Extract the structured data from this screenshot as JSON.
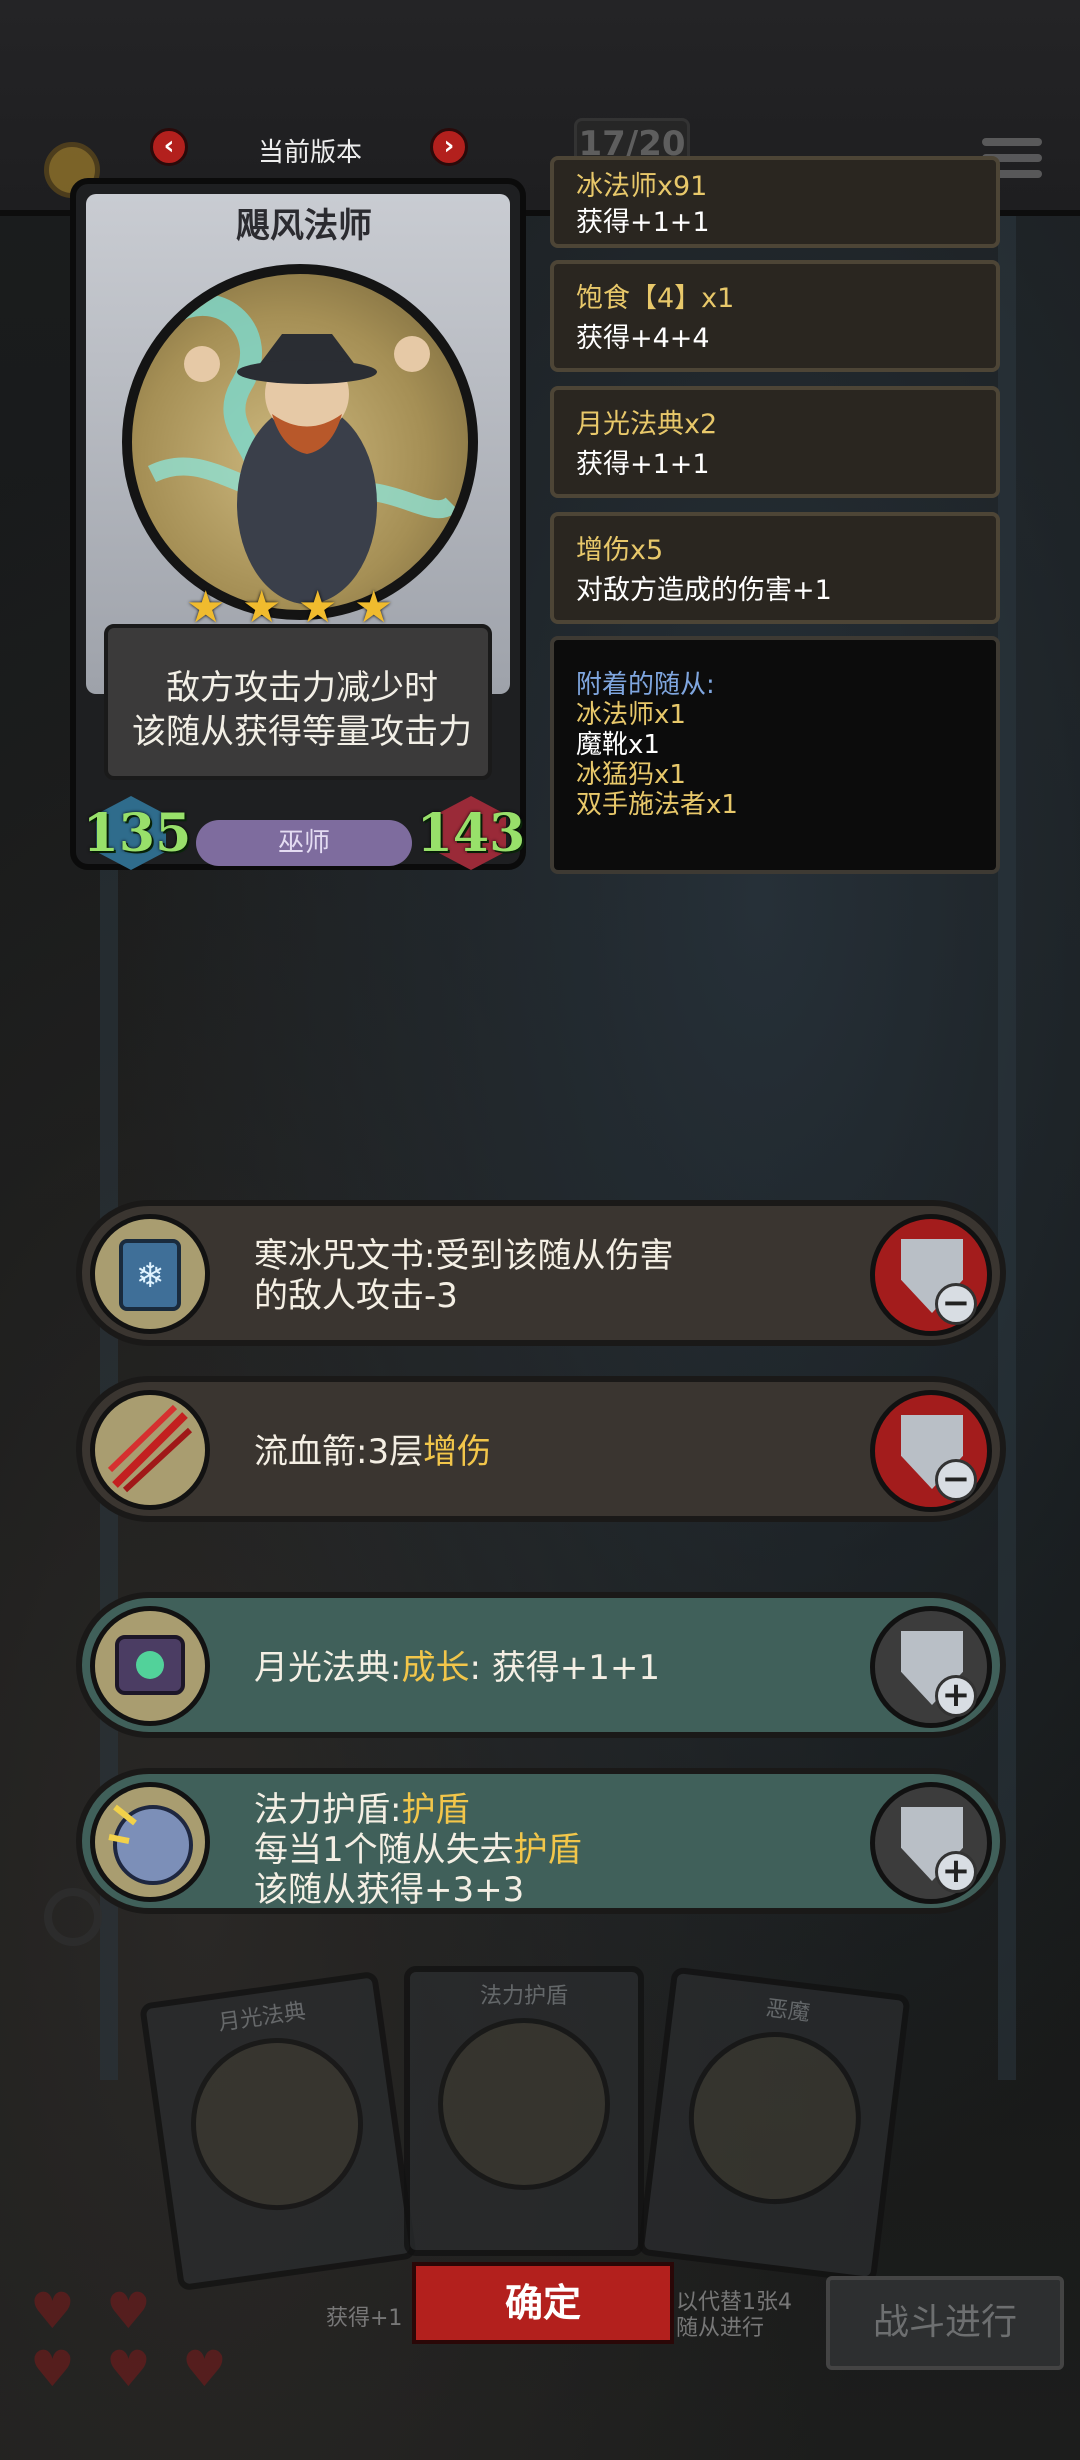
{
  "header": {
    "version_label": "当前版本",
    "prev_label": "‹",
    "next_label": "›",
    "counter": "17/20"
  },
  "hero": {
    "name": "飓风法师",
    "stars": 4,
    "description_line1": "敌方攻击力减少时",
    "description_line2": "该随从获得等量攻击力",
    "attack": "135",
    "health": "143",
    "tribe": "巫师"
  },
  "buffs": [
    {
      "title": "冰法师x91",
      "effect": "获得+1+1"
    },
    {
      "title": "饱食【4】x1",
      "effect": "获得+4+4"
    },
    {
      "title": "月光法典x2",
      "effect": "获得+1+1"
    },
    {
      "title": "增伤x5",
      "effect": "对敌方造成的伤害+1"
    }
  ],
  "attached": {
    "heading": "附着的随从:",
    "items": [
      {
        "label": "冰法师x1",
        "color": "#e8c86a"
      },
      {
        "label": "魔靴x1",
        "color": "#ffffff"
      },
      {
        "label": "冰猛犸x1",
        "color": "#e8c86a"
      },
      {
        "label": "双手施法者x1",
        "color": "#e8c86a"
      }
    ]
  },
  "effects": {
    "frost_book": {
      "line1": "寒冰咒文书:受到该随从伤害",
      "line2": "的敌人攻击-3"
    },
    "bleed_arrow": {
      "prefix": "流血箭:3层",
      "highlight": "增伤"
    },
    "moon_book": {
      "prefix": "月光法典:",
      "highlight": "成长",
      "suffix": ":  获得+1+1"
    },
    "mana_shield": {
      "line1_prefix": "法力护盾:",
      "line1_highlight": "护盾",
      "line2_prefix": "每当1个随从失去",
      "line2_highlight": "护盾",
      "line3": "该随从获得+3+3"
    }
  },
  "bottom": {
    "card1_title": "月光法典",
    "card2_title": "法力护盾",
    "card3_title": "恶魔",
    "faded_gain": "获得+1",
    "faded_replace": "以代替1张4",
    "faded_minion": "随从进行",
    "confirm_label": "确定",
    "battle_label": "战斗进行"
  },
  "colors": {
    "accent_red": "#b3201d",
    "highlight_gold": "#f2c64a",
    "stat_green": "#98e06a"
  }
}
